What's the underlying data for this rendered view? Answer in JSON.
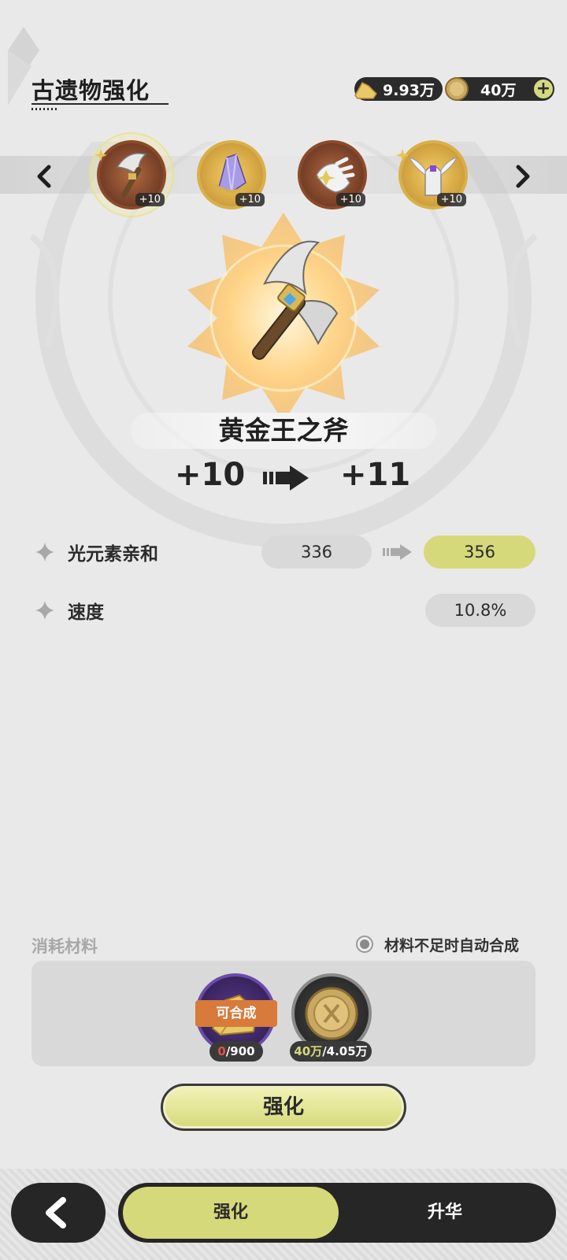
{
  "header": {
    "title": "古遗物强化",
    "currency_1": {
      "icon": "gold-ore-icon",
      "value": "9.93万"
    },
    "currency_2": {
      "icon": "gold-coin-icon",
      "value": "40万"
    },
    "add_label": "+"
  },
  "relics": [
    {
      "name": "golden-axe",
      "level": "+10",
      "starred": true,
      "selected": true
    },
    {
      "name": "crystal-relic",
      "level": "+10",
      "starred": false,
      "selected": false
    },
    {
      "name": "white-glove",
      "level": "+10",
      "starred": false,
      "selected": false
    },
    {
      "name": "winged-helmet",
      "level": "+10",
      "starred": true,
      "selected": false
    }
  ],
  "detail": {
    "name": "黄金王之斧",
    "level_from": "+10",
    "level_to": "+11"
  },
  "stats": [
    {
      "label": "光元素亲和",
      "current": "336",
      "next": "356"
    },
    {
      "label": "速度",
      "current": "10.8%"
    }
  ],
  "materials": {
    "title": "消耗材料",
    "auto_synth_label": "材料不足时自动合成",
    "items": [
      {
        "icon": "gold-ore-icon",
        "badge": "可合成",
        "have": "0",
        "need": "/900"
      },
      {
        "icon": "gold-coin-icon",
        "have": "40万",
        "need": "/4.05万"
      }
    ]
  },
  "enhance_button": "强化",
  "tabs": [
    {
      "label": "强化",
      "active": true
    },
    {
      "label": "升华",
      "active": false
    }
  ],
  "colors": {
    "accent": "#d6d97a",
    "dark": "#262626",
    "background": "#e9e9e9"
  }
}
